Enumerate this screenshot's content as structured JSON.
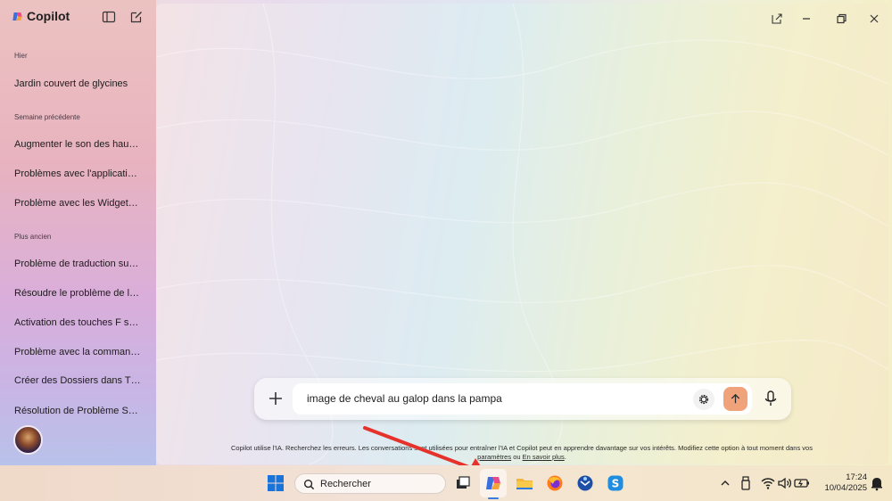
{
  "sidebar": {
    "brand": "Copilot",
    "sections": [
      {
        "label": "Hier",
        "items": [
          "Jardin couvert de glycines"
        ]
      },
      {
        "label": "Semaine précédente",
        "items": [
          "Augmenter le son des hau…",
          "Problèmes avec l'applicati…",
          "Problème avec les Widget…"
        ]
      },
      {
        "label": "Plus ancien",
        "items": [
          "Problème de traduction su…",
          "Résoudre le problème de l…",
          "Activation des touches F s…",
          "Problème avec la comman…",
          "Créer des Dossiers dans T…",
          "Résolution de Problème S…"
        ]
      }
    ]
  },
  "composer": {
    "input_value": "image de cheval au galop dans la pampa"
  },
  "disclaimer": {
    "line1": "Copilot utilise l'IA. Recherchez les erreurs. Les conversations sont utilisées pour entraîner l'IA et Copilot peut en apprendre davantage sur vos intérêts. Modifiez cette option à tout moment dans vos",
    "link1": "paramètres",
    "mid": " ou ",
    "link2": "En savoir plus",
    "end": "."
  },
  "taskbar": {
    "search_label": "Rechercher",
    "time": "17:24",
    "date": "10/04/2025"
  },
  "colors": {
    "send_button": "#f0a37a",
    "annotation_arrow": "#e5322b",
    "active_indicator": "#3a7be0"
  }
}
